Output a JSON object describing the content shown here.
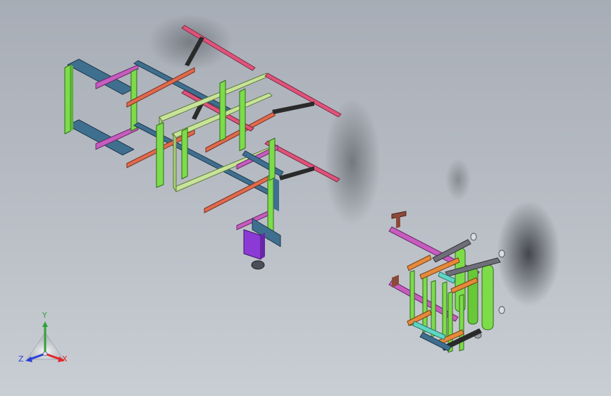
{
  "viewport": {
    "title": "",
    "background_top": "#a7adb6",
    "background_bottom": "#c9ced4"
  },
  "triad": {
    "x_label": "X",
    "y_label": "Y",
    "z_label": "Z",
    "x_color": "#e0262b",
    "y_color": "#2fa33a",
    "z_color": "#2b3fd6"
  },
  "model": {
    "part_colors": {
      "green": "#7ddc4a",
      "pink": "#e0537a",
      "steel_blue": "#3f6f8f",
      "salmon": "#e06a4d",
      "light_green": "#c8e39a",
      "magenta": "#c75cc0",
      "purple": "#8c3ad6",
      "dark": "#2a2a2a",
      "orange": "#e58a3a",
      "cyan": "#5fd6c4"
    }
  }
}
